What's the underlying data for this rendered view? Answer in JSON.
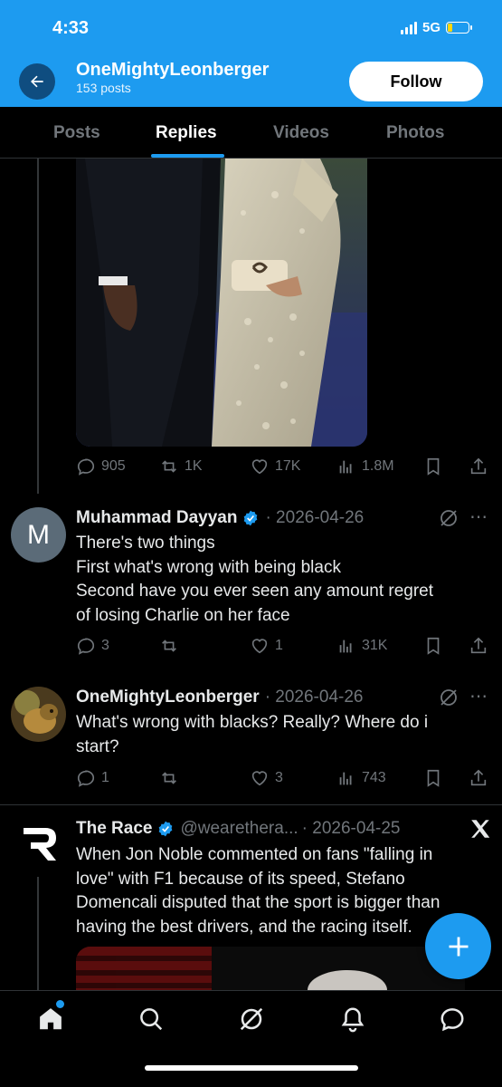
{
  "status_bar": {
    "time": "4:33",
    "network": "5G"
  },
  "header": {
    "profile_name": "OneMightyLeonberger",
    "post_count": "153 posts",
    "follow_label": "Follow"
  },
  "tabs": [
    {
      "label": "Posts",
      "active": false
    },
    {
      "label": "Replies",
      "active": true
    },
    {
      "label": "Videos",
      "active": false
    },
    {
      "label": "Photos",
      "active": false
    }
  ],
  "post1": {
    "replies": "905",
    "reposts": "1K",
    "likes": "17K",
    "views": "1.8M"
  },
  "reply1": {
    "author": "Muhammad Dayyan",
    "meta": "· 2026-04-26",
    "avatar_letter": "M",
    "lines": [
      "There's two things",
      "First what's wrong with being black",
      "Second have you ever seen any amount regret",
      "of losing Charlie on her face"
    ],
    "replies": "3",
    "reposts": "",
    "likes": "1",
    "views": "31K"
  },
  "reply2": {
    "author": "OneMightyLeonberger",
    "meta": "· 2026-04-26",
    "lines": [
      "What's wrong with blacks? Really? Where do i",
      "start?"
    ],
    "replies": "1",
    "reposts": "",
    "likes": "3",
    "views": "743"
  },
  "post2": {
    "author": "The Race",
    "handle": "@wearethera...",
    "meta": "· 2026-04-25",
    "lines": [
      "When Jon Noble commented on fans \"falling in",
      "love\" with F1 because of its speed, Stefano",
      "Domencali disputed that the sport is bigger than",
      "having the best drivers, and the racing itself."
    ]
  },
  "colors": {
    "accent": "#1d9bf0",
    "background": "#000000",
    "muted": "#71767b",
    "text": "#e7e9ea"
  }
}
